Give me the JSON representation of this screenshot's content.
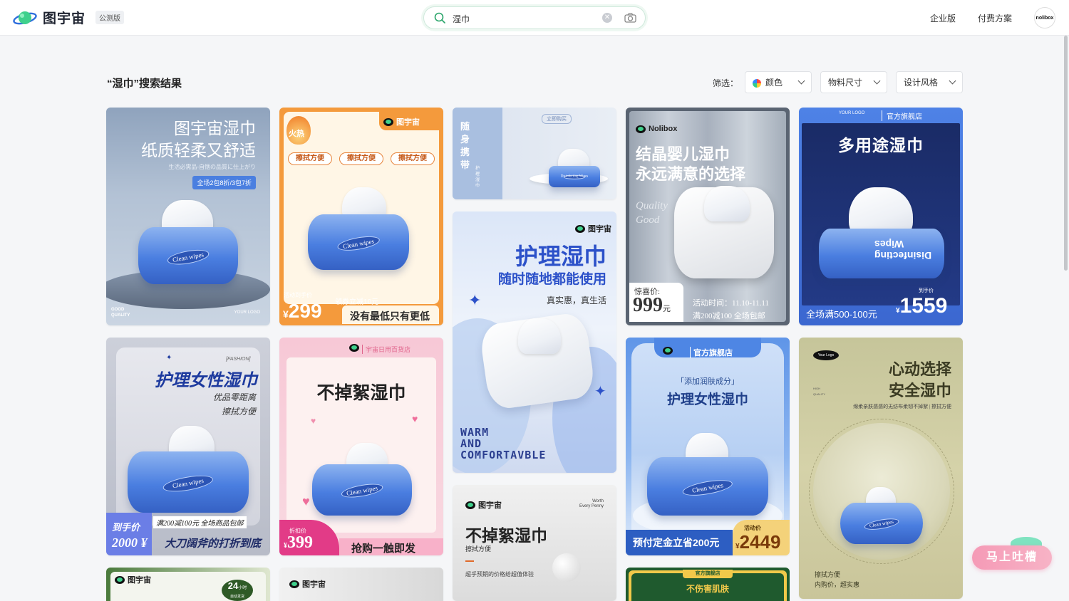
{
  "header": {
    "brand": "图宇宙",
    "beta_badge": "公测版",
    "search_value": "湿巾",
    "nav": [
      "企业版",
      "付费方案"
    ],
    "avatar_text": "nolibox"
  },
  "results": {
    "title": "“湿巾”搜索结果",
    "filter_label": "筛选：",
    "filters": [
      "颜色",
      "物料尺寸",
      "设计风格"
    ]
  },
  "cards": {
    "c1": {
      "title1": "图宇宙湿巾",
      "title2": "纸质轻柔又舒适",
      "subtitle": "生活必需品-自惬の品質に仕上がり",
      "badge": "全场2包8折/3包7折",
      "pack": "Clean wipes",
      "good": "GOOD",
      "quality": "QUALITY",
      "logo": "YOUR LOGO"
    },
    "c2": {
      "hot": "火热",
      "brand": "图宇宙",
      "chips": [
        "擦拭方便",
        "擦拭方便",
        "擦拭方便"
      ],
      "pack": "Clean wipes",
      "price_label": "活动到手价",
      "coupon": "领券立减10元",
      "currency": "¥",
      "price": "299",
      "slogan": "没有最低只有更低"
    },
    "c3": {
      "vertical": "随身携带",
      "tag": "立即购买",
      "sub": "护理湿巾",
      "pack": "Disinfecting Wipes"
    },
    "c4": {
      "brand": "Nolibox",
      "title1": "结晶婴儿湿巾",
      "title2": "永远满意的选择",
      "script1": "Quality",
      "script2": "Good",
      "price_label": "惊喜价:",
      "price": "999",
      "unit": "元",
      "event1": "活动时间：11.10-11.11",
      "event2": "满200减100 全场包邮"
    },
    "c5": {
      "store": "官方旗舰店",
      "logo": "YOUR LOGO",
      "title": "多用途湿巾",
      "pack1": "Disinfecting",
      "pack2": "Wipes",
      "promo": "全场满500-100元",
      "price_label": "到手价",
      "currency": "¥",
      "price": "1559"
    },
    "c6": {
      "brand": "图宇宙",
      "title1": "护理湿巾",
      "title2": "随时随地都能使用",
      "tagline": "真实惠，真生活",
      "en1": "WARM",
      "en2": "AND",
      "en3": "COMFORTAVBLE"
    },
    "c7": {
      "tag": "[FASHION]",
      "title": "护理女性湿巾",
      "sub1": "优品零距离",
      "sub2": "擦拭方便",
      "pack": "Clean wipes",
      "price_label": "到手价",
      "price": "2000 ¥",
      "promo": "满200减100元 全场商品包邮",
      "slogan": "大刀阔斧的打折到底"
    },
    "c8": {
      "shop": "宇宙日用百货店",
      "title": "不掉絮湿巾",
      "pack": "Clean wipes",
      "price_label": "折扣价",
      "currency": "¥",
      "price": "399",
      "slogan": "抢购一触即发"
    },
    "c9": {
      "store": "官方旗舰店",
      "sub": "「添加润肤成分」",
      "title": "护理女性湿巾",
      "pack": "Clean wipes",
      "promo": "预付定金立省200元",
      "price_label": "活动价",
      "currency": "¥",
      "price": "2449"
    },
    "c10": {
      "logo": "Your Logo",
      "title1": "心动选择",
      "title2": "安全湿巾",
      "high": "HIGH",
      "quality": "QUALITY",
      "desc": "绵柔亲肤感感的无纺布柔韧不掉絮 | 擦拭方便",
      "pack": "Clean wipes",
      "foot1": "擦拭方便",
      "foot2": "内购价，超实惠"
    },
    "c11": {
      "brand": "图宇宙",
      "title": "不掉絮湿巾",
      "sub": "擦拭方便",
      "corner1": "Worth",
      "corner2": "Every Penny",
      "desc": "超乎预期的价格给超值体验"
    },
    "c12": {
      "brand": "图宇宙",
      "badge_num": "24",
      "badge_unit": "小时",
      "badge_sub": "自动发货"
    },
    "c13": {
      "brand": "图宇宙"
    },
    "c14": {
      "store": "官方旗舰店",
      "title": "不伤害肌肤"
    }
  },
  "floating": {
    "label": "马上吐槽"
  }
}
